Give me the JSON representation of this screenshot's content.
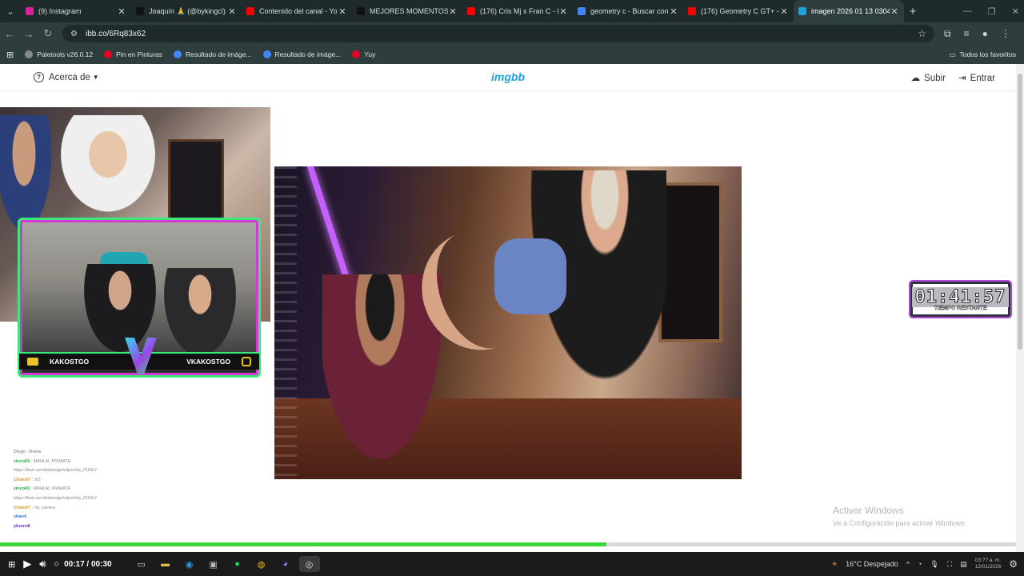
{
  "browser": {
    "tabs": [
      {
        "title": "(9) Instagram",
        "color": "#d6249f"
      },
      {
        "title": "Joaquín 🙏 (@bykingcl) |",
        "color": "#111111"
      },
      {
        "title": "Contenido del canal - You",
        "color": "#ff0000"
      },
      {
        "title": "MEJORES MOMENTOS DE",
        "color": "#111111"
      },
      {
        "title": "(176) Cris Mj x Fran C - El",
        "color": "#ff0000"
      },
      {
        "title": "geometry c - Buscar con",
        "color": "#4285f4"
      },
      {
        "title": "(176) Geometry C GT+ - F",
        "color": "#ff0000"
      },
      {
        "title": "imagen 2026 01 13 0304",
        "color": "#1fa2d8"
      }
    ],
    "url": "ibb.co/6Rq83x62",
    "bookmarks": [
      "Paletools v26.0.12",
      "Pin en Pinturas",
      "Resultado de imáge...",
      "Resultado de imáge...",
      "Yuy"
    ],
    "bookmarks_right": "Todos los favoritos"
  },
  "imgbb": {
    "about_label": "Acerca de",
    "logo": "imgbb",
    "upload_label": "Subir",
    "login_label": "Entrar"
  },
  "stream": {
    "social_left": "KAKOSTGO",
    "social_right": "VKAKOSTGO",
    "timer": "01:41:57",
    "timer_label": "TIEMPO RESTANTE",
    "chat": [
      {
        "user": "Diego_Videla",
        "msg": ""
      },
      {
        "user": "zinco65",
        "msg": "MIRA AL PRIMATE"
      },
      {
        "user": "",
        "msg": "https://kick.com/kakostgo/clips/clip_01KEV"
      },
      {
        "user": "Chalo07",
        "msg": "XD"
      },
      {
        "user": "zinco65",
        "msg": "MIRA AL PRIMATE"
      },
      {
        "user": "",
        "msg": "https://kick.com/kakostgo/clips/clip_01KEV"
      },
      {
        "user": "Chalo07",
        "msg": "nic carrera"
      },
      {
        "user": "shan4",
        "msg": ""
      },
      {
        "user": "ykzero8",
        "msg": ""
      }
    ]
  },
  "activate": {
    "title": "Activar Windows",
    "subtitle": "Ve a Configuración para activar Windows."
  },
  "player": {
    "time": "00:17 / 00:30",
    "progress_fraction": 0.597
  },
  "taskbar": {
    "weather": "16°C  Despejado",
    "clock_time": "03:?? a. m.",
    "clock_date": "13/01/2026"
  }
}
